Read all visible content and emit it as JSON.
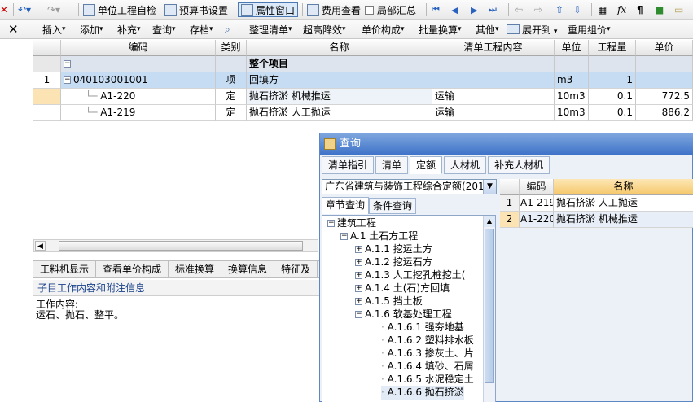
{
  "toolbar1": {
    "items": [
      "单位工程自检",
      "预算书设置",
      "属性窗口",
      "费用查看",
      "局部汇总"
    ]
  },
  "toolbar2": {
    "close": "✕",
    "menus": [
      "插入",
      "添加",
      "补充",
      "查询",
      "存档",
      "整理清单",
      "超高降效",
      "单价构成",
      "批量换算",
      "其他",
      "展开到",
      "重用组价"
    ]
  },
  "grid": {
    "headers": [
      "编码",
      "类别",
      "名称",
      "清单工程内容",
      "单位",
      "工程量",
      "单价"
    ],
    "group_row": {
      "toggle": "−",
      "name": "整个项目"
    },
    "rows": [
      {
        "no": "1",
        "toggle": "−",
        "code": "040103001001",
        "type": "项",
        "name": "回填方",
        "content": "",
        "unit": "m3",
        "qty": "1",
        "price": ""
      },
      {
        "no": "",
        "toggle": "",
        "code": "A1-220",
        "type": "定",
        "name": "抛石挤淤 机械推运",
        "content": "运输",
        "unit": "10m3",
        "qty": "0.1",
        "price": "772.5"
      },
      {
        "no": "",
        "toggle": "",
        "code": "A1-219",
        "type": "定",
        "name": "抛石挤淤 人工抛运",
        "content": "运输",
        "unit": "10m3",
        "qty": "0.1",
        "price": "886.2"
      }
    ]
  },
  "bottom_tabs": [
    "工料机显示",
    "查看单价构成",
    "标准换算",
    "换算信息",
    "特征及"
  ],
  "info": {
    "title": "子目工作内容和附注信息",
    "line1": "工作内容:",
    "line2": "运石、抛石、整平。"
  },
  "dialog": {
    "title": "查询",
    "tabs": [
      "清单指引",
      "清单",
      "定额",
      "人材机",
      "补充人材机"
    ],
    "quota_select": "广东省建筑与装饰工程综合定额(201",
    "subtabs": [
      "章节查询",
      "条件查询"
    ],
    "tree": [
      {
        "label": "建筑工程",
        "level": 0,
        "toggle": "−"
      },
      {
        "label": "A.1 土石方工程",
        "level": 1,
        "toggle": "−"
      },
      {
        "label": "A.1.1 挖运土方",
        "level": 2,
        "toggle": "+"
      },
      {
        "label": "A.1.2 挖运石方",
        "level": 2,
        "toggle": "+"
      },
      {
        "label": "A.1.3 人工挖孔桩挖土(",
        "level": 2,
        "toggle": "+"
      },
      {
        "label": "A.1.4 土(石)方回填",
        "level": 2,
        "toggle": "+"
      },
      {
        "label": "A.1.5 挡土板",
        "level": 2,
        "toggle": "+"
      },
      {
        "label": "A.1.6 软基处理工程",
        "level": 2,
        "toggle": "−"
      },
      {
        "label": "A.1.6.1 强夯地基",
        "level": 3,
        "toggle": ""
      },
      {
        "label": "A.1.6.2 塑料排水板",
        "level": 3,
        "toggle": ""
      },
      {
        "label": "A.1.6.3 掺灰土、片",
        "level": 3,
        "toggle": ""
      },
      {
        "label": "A.1.6.4 填砂、石屑",
        "level": 3,
        "toggle": ""
      },
      {
        "label": "A.1.6.5 水泥稳定土",
        "level": 3,
        "toggle": ""
      },
      {
        "label": "A.1.6.6 抛石挤淤",
        "level": 3,
        "toggle": ""
      }
    ],
    "result_headers": [
      "编码",
      "名称"
    ],
    "results": [
      {
        "no": "1",
        "code": "A1-219",
        "name": "抛石挤淤 人工抛运"
      },
      {
        "no": "2",
        "code": "A1-220",
        "name": "抛石挤淤 机械推运"
      }
    ]
  },
  "colors": {
    "accent": "#3f73c9",
    "selected_row": "#c6dcf3",
    "header_bg": "#e4e4e4"
  }
}
